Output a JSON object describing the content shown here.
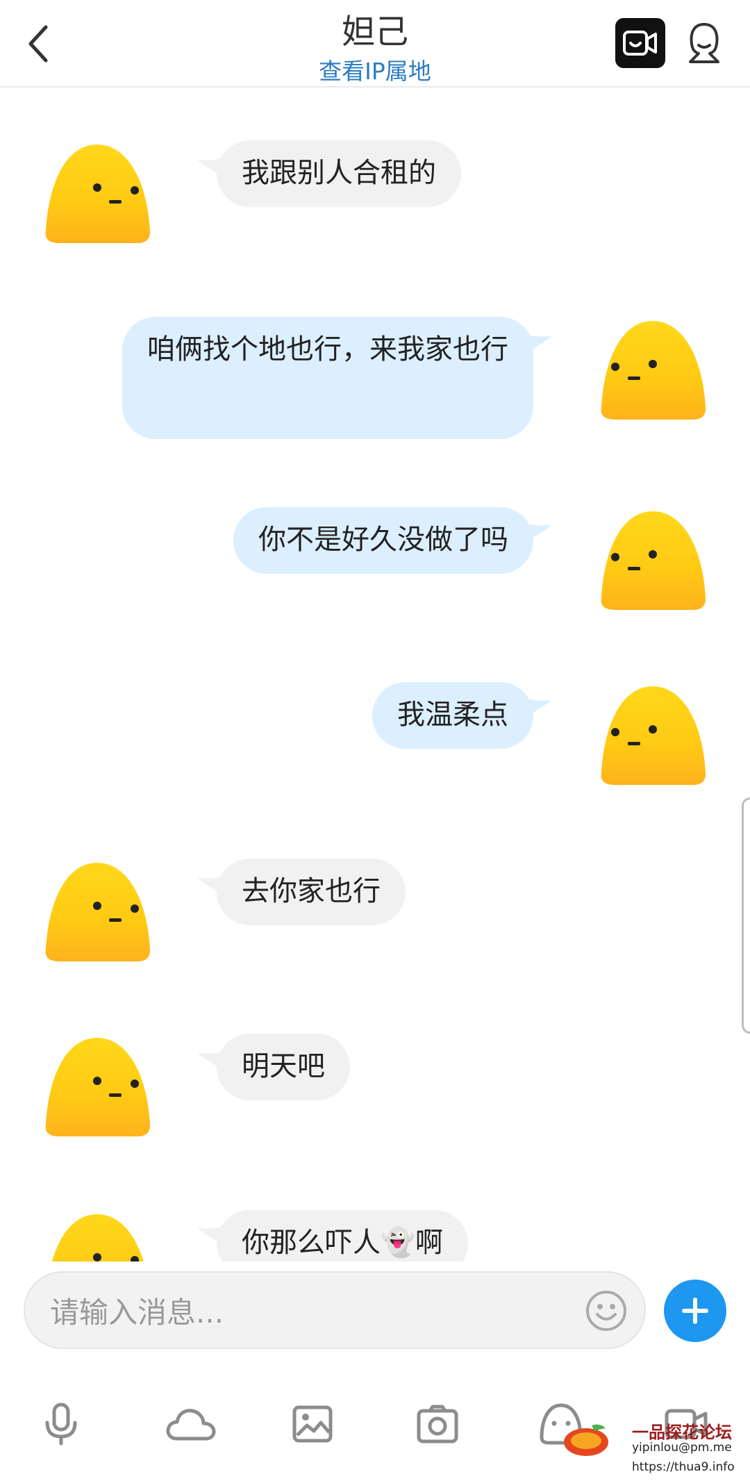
{
  "header": {
    "title": "妲己",
    "subtitle": "查看IP属地",
    "back_icon": "chevron-left-icon",
    "video_icon": "video-call-icon",
    "profile_icon": "profile-icon"
  },
  "messages": [
    {
      "side": "left",
      "text": "我跟别人合租的"
    },
    {
      "side": "right",
      "text": "咱俩找个地也行，来我家也行"
    },
    {
      "side": "right",
      "text": "你不是好久没做了吗"
    },
    {
      "side": "right",
      "text": "我温柔点"
    },
    {
      "side": "left",
      "text": "去你家也行"
    },
    {
      "side": "left",
      "text": "明天吧"
    },
    {
      "side": "left",
      "text": "你那么吓人",
      "emoji": "👻",
      "text_after": "啊"
    }
  ],
  "input": {
    "placeholder": "请输入消息..."
  },
  "toolbar": {
    "items": [
      "microphone-icon",
      "cloud-icon",
      "image-icon",
      "camera-icon",
      "sticker-icon",
      "video-icon"
    ]
  },
  "watermark": {
    "title": "一品探花论坛",
    "email": "yipinlou@pm.me",
    "url": "https://thua9.info"
  },
  "colors": {
    "accent": "#1d97f0",
    "sent_bubble": "#dcefff",
    "received_bubble": "#f1f1f1",
    "link": "#2b7cc1"
  }
}
